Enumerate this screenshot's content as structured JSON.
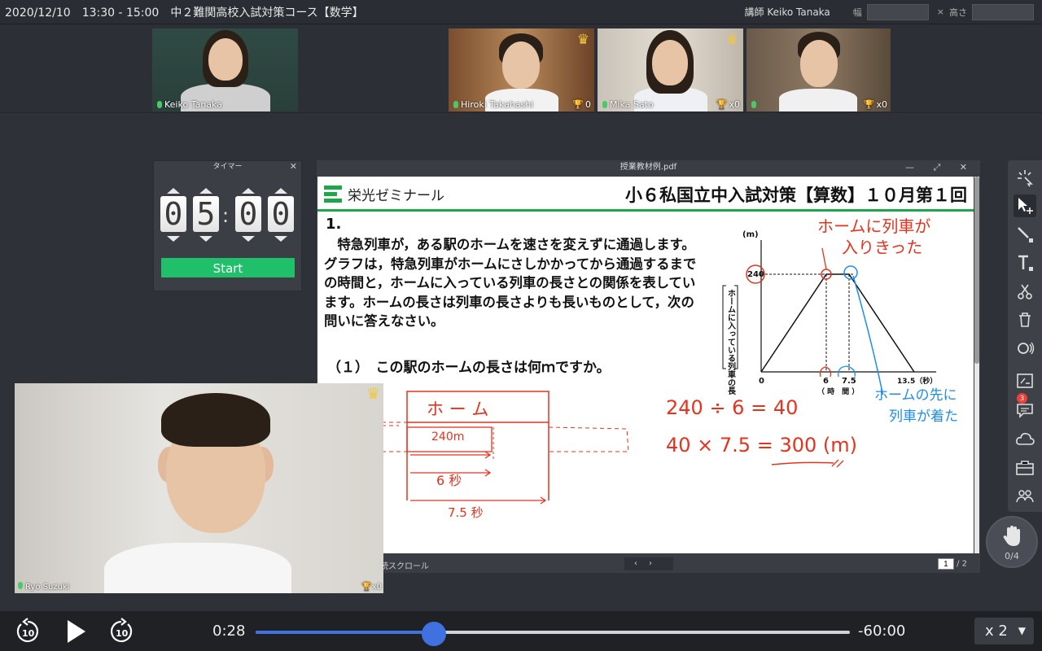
{
  "header": {
    "session_title": "2020/12/10　13:30 - 15:00　中２難関高校入試対策コース【数学】",
    "teacher_label": "講師",
    "teacher_name": "Keiko Tanaka",
    "width_label": "幅",
    "height_label": "高さ",
    "width_value": "",
    "height_value": ""
  },
  "participants": [
    {
      "name": "Keiko Tanaka",
      "role": "teacher"
    },
    {
      "name": "Hiroki Takahashi",
      "trophies": "0",
      "crown": true
    },
    {
      "name": "Mika Sato",
      "trophies": "x0",
      "crown": true
    },
    {
      "name": "",
      "trophies": "x0",
      "crown": false
    }
  ],
  "timer": {
    "title": "タイマー",
    "digits": [
      "0",
      "5",
      "0",
      "0"
    ],
    "separator": ":",
    "start_label": "Start"
  },
  "pdf": {
    "filename": "授業教材例.pdf",
    "window_controls": "— ⤢ ✕",
    "logo_text": "栄光ゼミナール",
    "doc_title": "小６私国立中入試対策【算数】１０月第１回",
    "question_number": "1.",
    "question_text": "　特急列車が，ある駅のホームを速さを変えずに通過します。グラフは，特急列車がホームにさしかかってから通過するまでの時間と，ホームに入っている列車の長さとの関係を表しています。ホームの長さは列車の長さよりも長いものとして，次の問いに答えなさい。",
    "sub_question": "（１）　この駅のホームの長さは何ｍですか。",
    "graph": {
      "unit_y": "(m)",
      "y_value": "240",
      "y_label": "ホームに入っている列車の長さ",
      "x_ticks": [
        "0",
        "6",
        "7.5",
        "13.5（秒）"
      ],
      "x_label": "（ 時　間 ）"
    },
    "annotations": {
      "red_top": [
        "ホームに列車が",
        "入りきった"
      ],
      "blue_side": [
        "ホームの先に",
        "列車が着た"
      ],
      "home": "ホ ー ム",
      "length": "240m",
      "time1": "6 秒",
      "time2": "7.5 秒",
      "calc1": "240 ÷ 6 = 40",
      "calc2": "40 × 7.5 = 300 (m)"
    },
    "footer_scroll": "連続スクロール",
    "nav_prev": "‹",
    "nav_next": "›",
    "page_current": "1",
    "page_total": "/ 2"
  },
  "toolbar": {
    "tools": [
      "laser-pointer",
      "select-move",
      "pen",
      "text",
      "scissors",
      "trash",
      "zoom-loop",
      "formula",
      "chat",
      "cloud",
      "toolbox",
      "participants"
    ],
    "chat_badge": "3",
    "raise_hand_count": "0/4"
  },
  "self_camera": {
    "name": "Ryo Suzuki",
    "trophies": "x0",
    "crown": true
  },
  "player": {
    "elapsed": "0:28",
    "remaining": "-60:00",
    "progress": 0.3,
    "skip_back": "10",
    "skip_forward": "10",
    "speed": "x 2"
  },
  "colors": {
    "accent": "#3f72e0",
    "start_button": "#20c06a",
    "logo_green": "#1ea64a",
    "annotation_red": "#e8321e",
    "annotation_blue": "#1e8ee8",
    "crown": "#f3c63b"
  }
}
